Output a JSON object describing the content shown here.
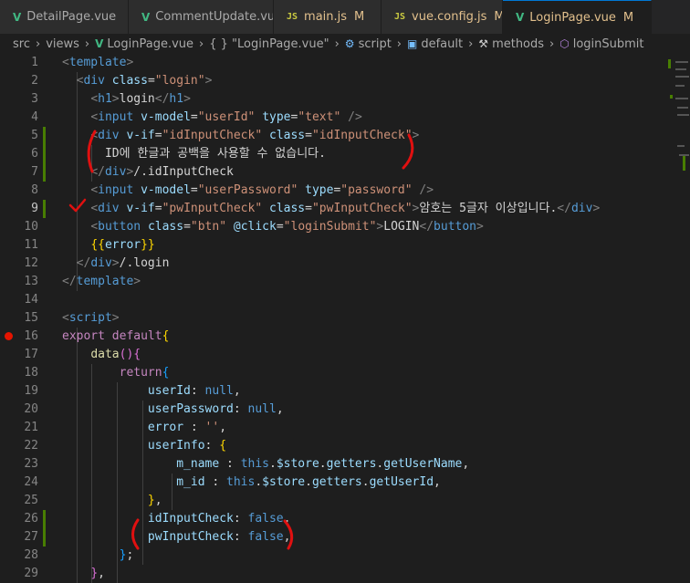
{
  "tabs": [
    {
      "icon": "vue-icon",
      "name": "DetailPage.vue",
      "mark": "",
      "modified": false,
      "active": false
    },
    {
      "icon": "vue-icon",
      "name": "CommentUpdate.vue",
      "mark": "",
      "modified": false,
      "active": false
    },
    {
      "icon": "js-icon",
      "name": "main.js",
      "mark": "M",
      "modified": true,
      "active": false
    },
    {
      "icon": "js-icon",
      "name": "vue.config.js",
      "mark": "M",
      "modified": true,
      "active": false
    },
    {
      "icon": "vue-icon",
      "name": "LoginPage.vue",
      "mark": "M",
      "modified": true,
      "active": true
    }
  ],
  "js_label": "JS",
  "breadcrumb": {
    "src": "src",
    "views": "views",
    "file": "LoginPage.vue",
    "template": "{ } \"LoginPage.vue\"",
    "script": "script",
    "default": "default",
    "methods": "methods",
    "submit": "loginSubmit"
  },
  "lines": [
    {
      "n": "1",
      "segs": [
        [
          "t",
          "<"
        ],
        [
          "tg",
          "template"
        ],
        [
          "t",
          ">"
        ]
      ]
    },
    {
      "n": "2",
      "segs": [
        [
          "tx",
          "  "
        ],
        [
          "t",
          "<"
        ],
        [
          "tg",
          "div"
        ],
        [
          "tx",
          " "
        ],
        [
          "at",
          "class"
        ],
        [
          "tx",
          "="
        ],
        [
          "sv",
          "\"login\""
        ],
        [
          "t",
          ">"
        ]
      ]
    },
    {
      "n": "3",
      "segs": [
        [
          "tx",
          "    "
        ],
        [
          "t",
          "<"
        ],
        [
          "tg",
          "h1"
        ],
        [
          "t",
          ">"
        ],
        [
          "tx",
          "login"
        ],
        [
          "t",
          "</"
        ],
        [
          "tg",
          "h1"
        ],
        [
          "t",
          ">"
        ]
      ]
    },
    {
      "n": "4",
      "segs": [
        [
          "tx",
          "    "
        ],
        [
          "t",
          "<"
        ],
        [
          "tg",
          "input"
        ],
        [
          "tx",
          " "
        ],
        [
          "at",
          "v-model"
        ],
        [
          "tx",
          "="
        ],
        [
          "sv",
          "\"userId\""
        ],
        [
          "tx",
          " "
        ],
        [
          "at",
          "type"
        ],
        [
          "tx",
          "="
        ],
        [
          "sv",
          "\"text\""
        ],
        [
          "tx",
          " "
        ],
        [
          "t",
          "/>"
        ]
      ]
    },
    {
      "n": "5",
      "segs": [
        [
          "tx",
          "    "
        ],
        [
          "t",
          "<"
        ],
        [
          "tg",
          "div"
        ],
        [
          "tx",
          " "
        ],
        [
          "at",
          "v-if"
        ],
        [
          "tx",
          "="
        ],
        [
          "sv",
          "\"idInputCheck\""
        ],
        [
          "tx",
          " "
        ],
        [
          "at",
          "class"
        ],
        [
          "tx",
          "="
        ],
        [
          "sv",
          "\"idInputCheck\""
        ],
        [
          "t",
          ">"
        ]
      ]
    },
    {
      "n": "6",
      "segs": [
        [
          "tx",
          "      ID에 한글과 공백을 사용할 수 없습니다."
        ]
      ]
    },
    {
      "n": "7",
      "segs": [
        [
          "tx",
          "    "
        ],
        [
          "t",
          "</"
        ],
        [
          "tg",
          "div"
        ],
        [
          "t",
          ">"
        ],
        [
          "tx",
          "/.idInputCheck"
        ]
      ]
    },
    {
      "n": "8",
      "segs": [
        [
          "tx",
          "    "
        ],
        [
          "t",
          "<"
        ],
        [
          "tg",
          "input"
        ],
        [
          "tx",
          " "
        ],
        [
          "at",
          "v-model"
        ],
        [
          "tx",
          "="
        ],
        [
          "sv",
          "\"userPassword\""
        ],
        [
          "tx",
          " "
        ],
        [
          "at",
          "type"
        ],
        [
          "tx",
          "="
        ],
        [
          "sv",
          "\"password\""
        ],
        [
          "tx",
          " "
        ],
        [
          "t",
          "/>"
        ]
      ]
    },
    {
      "n": "9",
      "segs": [
        [
          "tx",
          "    "
        ],
        [
          "t",
          "<"
        ],
        [
          "tg",
          "div"
        ],
        [
          "tx",
          " "
        ],
        [
          "at",
          "v-if"
        ],
        [
          "tx",
          "="
        ],
        [
          "sv",
          "\"pwInputCheck\""
        ],
        [
          "tx",
          " "
        ],
        [
          "at",
          "class"
        ],
        [
          "tx",
          "="
        ],
        [
          "sv",
          "\"pwInputCheck\""
        ],
        [
          "t",
          ">"
        ],
        [
          "tx",
          "암호는 5글자 이상입니다."
        ],
        [
          "t",
          "</"
        ],
        [
          "tg",
          "div"
        ],
        [
          "t",
          ">"
        ]
      ]
    },
    {
      "n": "10",
      "segs": [
        [
          "tx",
          "    "
        ],
        [
          "t",
          "<"
        ],
        [
          "tg",
          "button"
        ],
        [
          "tx",
          " "
        ],
        [
          "at",
          "class"
        ],
        [
          "tx",
          "="
        ],
        [
          "sv",
          "\"btn\""
        ],
        [
          "tx",
          " "
        ],
        [
          "at",
          "@click"
        ],
        [
          "tx",
          "="
        ],
        [
          "sv",
          "\"loginSubmit\""
        ],
        [
          "t",
          ">"
        ],
        [
          "tx",
          "LOGIN"
        ],
        [
          "t",
          "</"
        ],
        [
          "tg",
          "button"
        ],
        [
          "t",
          ">"
        ]
      ]
    },
    {
      "n": "11",
      "segs": [
        [
          "tx",
          "    "
        ],
        [
          "br1",
          "{{"
        ],
        [
          "pr",
          "error"
        ],
        [
          "br1",
          "}}"
        ]
      ]
    },
    {
      "n": "12",
      "segs": [
        [
          "tx",
          "  "
        ],
        [
          "t",
          "</"
        ],
        [
          "tg",
          "div"
        ],
        [
          "t",
          ">"
        ],
        [
          "tx",
          "/.login"
        ]
      ]
    },
    {
      "n": "13",
      "segs": [
        [
          "t",
          "</"
        ],
        [
          "tg",
          "template"
        ],
        [
          "t",
          ">"
        ]
      ]
    },
    {
      "n": "14",
      "segs": []
    },
    {
      "n": "15",
      "segs": [
        [
          "t",
          "<"
        ],
        [
          "tg",
          "script"
        ],
        [
          "t",
          ">"
        ]
      ]
    },
    {
      "n": "16",
      "segs": [
        [
          "kw",
          "export"
        ],
        [
          "tx",
          " "
        ],
        [
          "kw",
          "default"
        ],
        [
          "br1",
          "{"
        ]
      ]
    },
    {
      "n": "17",
      "segs": [
        [
          "tx",
          "    "
        ],
        [
          "fn",
          "data"
        ],
        [
          "br2",
          "()"
        ],
        [
          "br2",
          "{"
        ]
      ]
    },
    {
      "n": "18",
      "segs": [
        [
          "tx",
          "        "
        ],
        [
          "kw",
          "return"
        ],
        [
          "br3",
          "{"
        ]
      ]
    },
    {
      "n": "19",
      "segs": [
        [
          "tx",
          "            "
        ],
        [
          "pr",
          "userId"
        ],
        [
          "tx",
          ": "
        ],
        [
          "cn",
          "null"
        ],
        [
          "tx",
          ","
        ]
      ]
    },
    {
      "n": "20",
      "segs": [
        [
          "tx",
          "            "
        ],
        [
          "pr",
          "userPassword"
        ],
        [
          "tx",
          ": "
        ],
        [
          "cn",
          "null"
        ],
        [
          "tx",
          ","
        ]
      ]
    },
    {
      "n": "21",
      "segs": [
        [
          "tx",
          "            "
        ],
        [
          "pr",
          "error"
        ],
        [
          "tx",
          " : "
        ],
        [
          "sv",
          "''"
        ],
        [
          "tx",
          ","
        ]
      ]
    },
    {
      "n": "22",
      "segs": [
        [
          "tx",
          "            "
        ],
        [
          "pr",
          "userInfo"
        ],
        [
          "tx",
          ": "
        ],
        [
          "br1",
          "{"
        ]
      ]
    },
    {
      "n": "23",
      "segs": [
        [
          "tx",
          "                "
        ],
        [
          "pr",
          "m_name"
        ],
        [
          "tx",
          " : "
        ],
        [
          "cn",
          "this"
        ],
        [
          "tx",
          "."
        ],
        [
          "pr",
          "$store"
        ],
        [
          "tx",
          "."
        ],
        [
          "pr",
          "getters"
        ],
        [
          "tx",
          "."
        ],
        [
          "pr",
          "getUserName"
        ],
        [
          "tx",
          ","
        ]
      ]
    },
    {
      "n": "24",
      "segs": [
        [
          "tx",
          "                "
        ],
        [
          "pr",
          "m_id"
        ],
        [
          "tx",
          " : "
        ],
        [
          "cn",
          "this"
        ],
        [
          "tx",
          "."
        ],
        [
          "pr",
          "$store"
        ],
        [
          "tx",
          "."
        ],
        [
          "pr",
          "getters"
        ],
        [
          "tx",
          "."
        ],
        [
          "pr",
          "getUserId"
        ],
        [
          "tx",
          ","
        ]
      ]
    },
    {
      "n": "25",
      "segs": [
        [
          "tx",
          "            "
        ],
        [
          "br1",
          "}"
        ],
        [
          "tx",
          ","
        ]
      ]
    },
    {
      "n": "26",
      "segs": [
        [
          "tx",
          "            "
        ],
        [
          "pr",
          "idInputCheck"
        ],
        [
          "tx",
          ": "
        ],
        [
          "cn",
          "false"
        ],
        [
          "tx",
          ","
        ]
      ]
    },
    {
      "n": "27",
      "segs": [
        [
          "tx",
          "            "
        ],
        [
          "pr",
          "pwInputCheck"
        ],
        [
          "tx",
          ": "
        ],
        [
          "cn",
          "false"
        ],
        [
          "tx",
          ","
        ]
      ]
    },
    {
      "n": "28",
      "segs": [
        [
          "tx",
          "        "
        ],
        [
          "br3",
          "}"
        ],
        [
          "tx",
          ";"
        ]
      ]
    },
    {
      "n": "29",
      "segs": [
        [
          "tx",
          "    "
        ],
        [
          "br2",
          "}"
        ],
        [
          "tx",
          ","
        ]
      ]
    }
  ],
  "modified_lines": [
    "5",
    "6",
    "7",
    "9",
    "26",
    "27"
  ],
  "breakpoint_line": "16",
  "current_line": "9",
  "colors": {
    "accent": "#0078d4",
    "vue": "#41b883",
    "modified": "#e2c08d",
    "annotation": "#e01010",
    "gutter_added": "#487e02"
  }
}
